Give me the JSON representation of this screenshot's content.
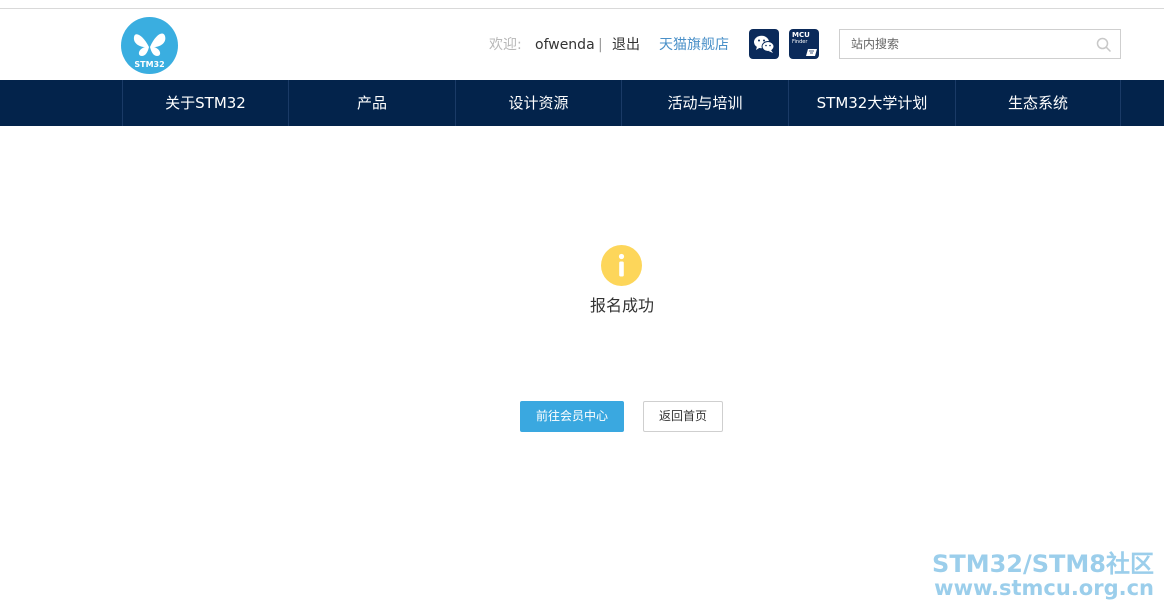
{
  "header": {
    "logo_text": "STM32",
    "welcome_label": "欢迎:",
    "username": "ofwenda",
    "separator": "|",
    "logout": "退出",
    "tmall_store": "天猫旗舰店",
    "mcu_finder_line1": "MCU",
    "mcu_finder_line2": "Finder"
  },
  "search": {
    "placeholder": "站内搜索",
    "value": ""
  },
  "nav": {
    "items": [
      {
        "label": "关于STM32"
      },
      {
        "label": "产品"
      },
      {
        "label": "设计资源"
      },
      {
        "label": "活动与培训"
      },
      {
        "label": "STM32大学计划"
      },
      {
        "label": "生态系统"
      }
    ]
  },
  "main": {
    "message": "报名成功",
    "primary_button": "前往会员中心",
    "secondary_button": "返回首页"
  },
  "watermark": {
    "line1": "STM32/STM8社区",
    "line2": "www.stmcu.org.cn"
  },
  "colors": {
    "nav_background": "#03234b",
    "primary_button": "#3aa8e0",
    "logo": "#3aaee0",
    "info_icon": "#fdd65a",
    "link": "#4a90c8"
  }
}
